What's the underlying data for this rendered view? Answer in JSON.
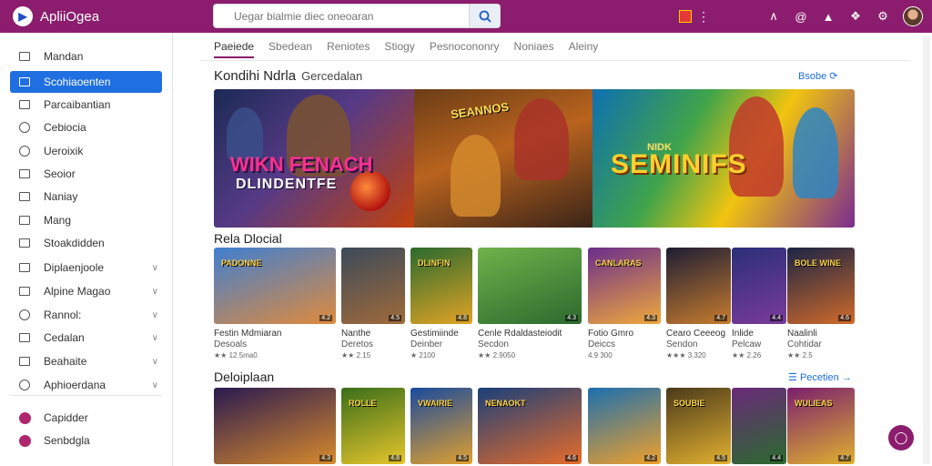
{
  "app": {
    "title": "ApliiOgea"
  },
  "search": {
    "placeholder": "Uegar bialmie diec oneoaran"
  },
  "sidebar": {
    "items": [
      {
        "label": "Mandan",
        "icon": "menu-icon"
      },
      {
        "label": "Scohiaoenten",
        "icon": "grid-icon",
        "active": true
      },
      {
        "label": "Parcaibantian",
        "icon": "grid-icon"
      },
      {
        "label": "Cebiocia",
        "icon": "circle-icon"
      },
      {
        "label": "Ueroixik",
        "icon": "circle-icon"
      },
      {
        "label": "Seoior",
        "icon": "grid-icon"
      },
      {
        "label": "Naniay",
        "icon": "star-icon"
      },
      {
        "label": "Mang",
        "icon": "tool-icon"
      },
      {
        "label": "Stoakdidden",
        "icon": "grid-icon"
      },
      {
        "label": "Diplaenjoole",
        "icon": "grid-icon"
      },
      {
        "label": "Alpine Magao",
        "icon": "grid-icon"
      },
      {
        "label": "Rannol:",
        "icon": "circle-icon"
      },
      {
        "label": "Cedalan",
        "icon": "grid-icon"
      },
      {
        "label": "Beahaite",
        "icon": "grid-icon"
      },
      {
        "label": "Aphioerdana",
        "icon": "circle-icon"
      },
      {
        "label": "Capidder",
        "icon": "pink-icon"
      },
      {
        "label": "Senbdgla",
        "icon": "pink-icon"
      }
    ]
  },
  "tabs": [
    "Paeiede",
    "Sbedean",
    "Reniotes",
    "Stiogy",
    "Pesnocononry",
    "Noniaes",
    "Aleiny"
  ],
  "featured": {
    "title": "Kondihi Ndrla",
    "subtitle": "Gercedalan",
    "link": "Bsobe",
    "panels": [
      {
        "line1": "WIKN FENACH",
        "line2": "DLINDENTFE"
      },
      {
        "line1": "SEANNOS"
      },
      {
        "line1": "NIDK",
        "line2": "SEMINIFS"
      }
    ]
  },
  "section2": {
    "title": "Rela Dlocial",
    "cards": [
      {
        "art": "PADONNE",
        "name": "Festin Mdmiaran",
        "genre": "Desoals",
        "meta": "★★ 12.5ma0",
        "badge": "4.2"
      },
      {
        "art": "",
        "name": "Nanthe",
        "genre": "Deretos",
        "meta": "★★ 2.15",
        "badge": "4.5"
      },
      {
        "art": "DLINFIN",
        "name": "Gestimiinde",
        "genre": "Deinber",
        "meta": "★ 2100",
        "badge": "4.8"
      },
      {
        "art": "",
        "name": "Cenle Rdaldasteiodit",
        "genre": "Secdon",
        "meta": "★★ 2.9050",
        "badge": "4.3"
      },
      {
        "art": "CANLARAS",
        "name": "Fotio Gmro",
        "genre": "Deiccs",
        "meta": "4.9 300",
        "badge": "4.3"
      },
      {
        "art": "",
        "name": "Cearo Ceeeog",
        "genre": "Sendon",
        "meta": "★★★ 3.320",
        "badge": "4.7"
      },
      {
        "art": "",
        "name": "Inlide",
        "genre": "Pelcaw",
        "meta": "★★ 2.26",
        "badge": "4.4"
      },
      {
        "art": "BOLE WINE",
        "name": "Naalinli",
        "genre": "Cohtidar",
        "meta": "★★ 2.5",
        "badge": "4.6"
      }
    ]
  },
  "section3": {
    "title": "Deloiplaan",
    "link": "Pecetien",
    "cards": [
      {
        "art": "",
        "badge": "4.3"
      },
      {
        "art": "ROLLE",
        "badge": "4.8"
      },
      {
        "art": "VWAIRIE",
        "badge": "4.5"
      },
      {
        "art": "NENAOKT",
        "badge": "4.6"
      },
      {
        "art": "",
        "badge": "4.2"
      },
      {
        "art": "SOUBIE",
        "badge": "4.5"
      },
      {
        "art": "",
        "badge": "4.4"
      },
      {
        "art": "WULIEAS",
        "badge": "4.7"
      }
    ]
  },
  "colors": {
    "brand": "#8c1d6e",
    "accent": "#1f6fe0"
  }
}
